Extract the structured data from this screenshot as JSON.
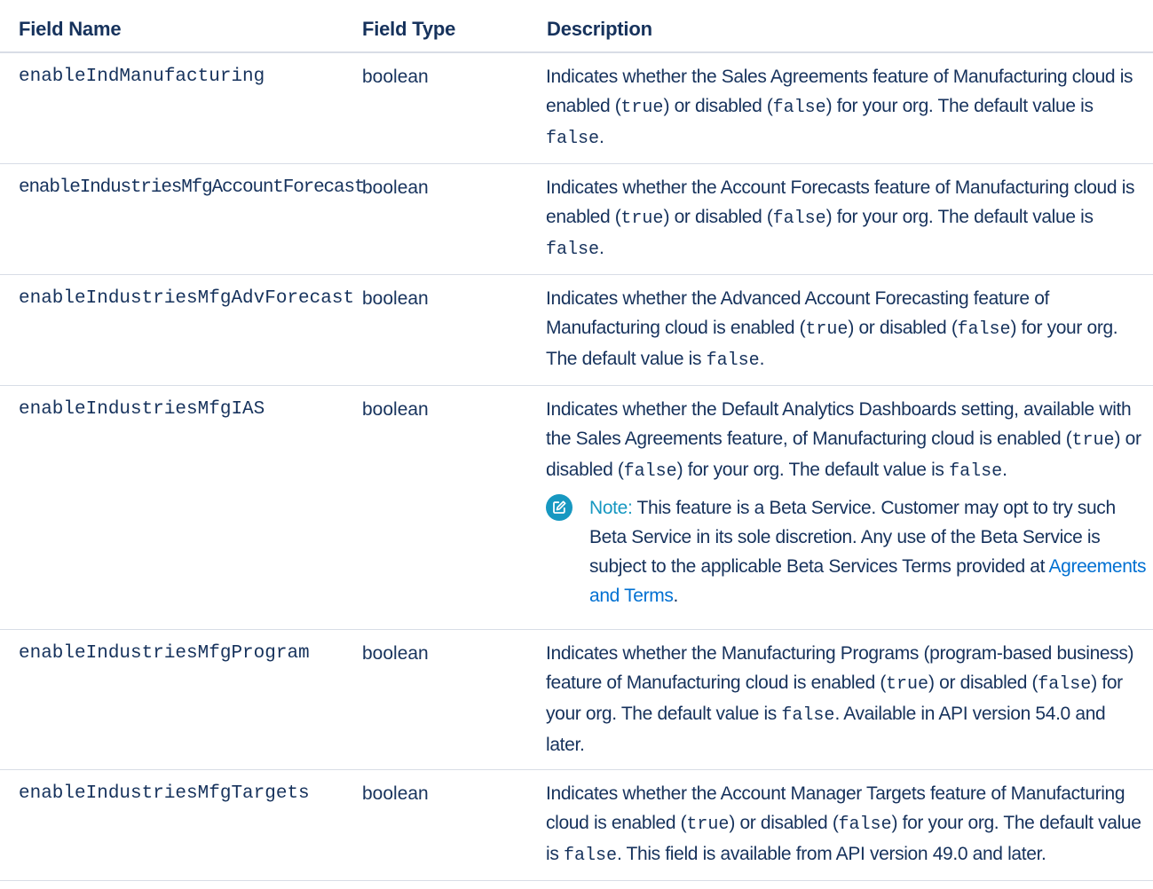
{
  "columns": {
    "field_name": "Field Name",
    "field_type": "Field Type",
    "description": "Description"
  },
  "rows": [
    {
      "name": "enableIndManufacturing",
      "type": "boolean",
      "desc_a": "Indicates whether the Sales Agreements feature of Manufacturing cloud is enabled (",
      "true_text": "true",
      "desc_b": ") or disabled (",
      "false_text": "false",
      "desc_c": ") for your org. The default value is ",
      "default_text": "false",
      "desc_d": "."
    },
    {
      "name": "enableIndustriesMfgAccountForecast",
      "type": "boolean",
      "desc_a": "Indicates whether the Account Forecasts feature of Manufacturing cloud is enabled (",
      "true_text": "true",
      "desc_b": ") or disabled (",
      "false_text": "false",
      "desc_c": ") for your org. The default value is ",
      "default_text": "false",
      "desc_d": "."
    },
    {
      "name": "enableIndustriesMfgAdvForecast",
      "type": "boolean",
      "desc_a": "Indicates whether the Advanced Account Forecasting feature of Manufacturing cloud is enabled (",
      "true_text": "true",
      "desc_b": ") or disabled (",
      "false_text": "false",
      "desc_c": ") for your org. The default value is ",
      "default_text": "false",
      "desc_d": "."
    },
    {
      "name": "enableIndustriesMfgIAS",
      "type": "boolean",
      "desc_a": "Indicates whether the Default Analytics Dashboards setting, available with the Sales Agreements feature, of Manufacturing cloud is enabled (",
      "true_text": "true",
      "desc_b": ") or disabled (",
      "false_text": "false",
      "desc_c": ") for your org. The default value is ",
      "default_text": "false",
      "desc_d": ".",
      "note": {
        "label": "Note:",
        "text": " This feature is a Beta Service. Customer may opt to try such Beta Service in its sole discretion. Any use of the Beta Service is subject to the applicable Beta Services Terms provided at ",
        "link_text": "Agreements and Terms",
        "end": ".",
        "icon": "edit-note-icon",
        "icon_color": "#1798c1",
        "link_color": "#0070d2"
      }
    },
    {
      "name": "enableIndustriesMfgProgram",
      "type": "boolean",
      "desc_a": "Indicates whether the Manufacturing Programs (program-based business) feature of Manufacturing cloud is enabled (",
      "true_text": "true",
      "desc_b": ") or disabled (",
      "false_text": "false",
      "desc_c": ") for your org. The default value is ",
      "default_text": "false",
      "desc_d": ". Available in API version 54.0 and later."
    },
    {
      "name": "enableIndustriesMfgTargets",
      "type": "boolean",
      "desc_a": "Indicates whether the Account Manager Targets feature of Manufacturing cloud is enabled (",
      "true_text": "true",
      "desc_b": ") or disabled (",
      "false_text": "false",
      "desc_c": ") for your org. The default value is ",
      "default_text": "false",
      "desc_d": ". This field is available from API version 49.0 and later."
    }
  ],
  "colors": {
    "text": "#16325c",
    "border": "#d8dde6",
    "accent": "#1798c1",
    "link": "#0070d2"
  }
}
